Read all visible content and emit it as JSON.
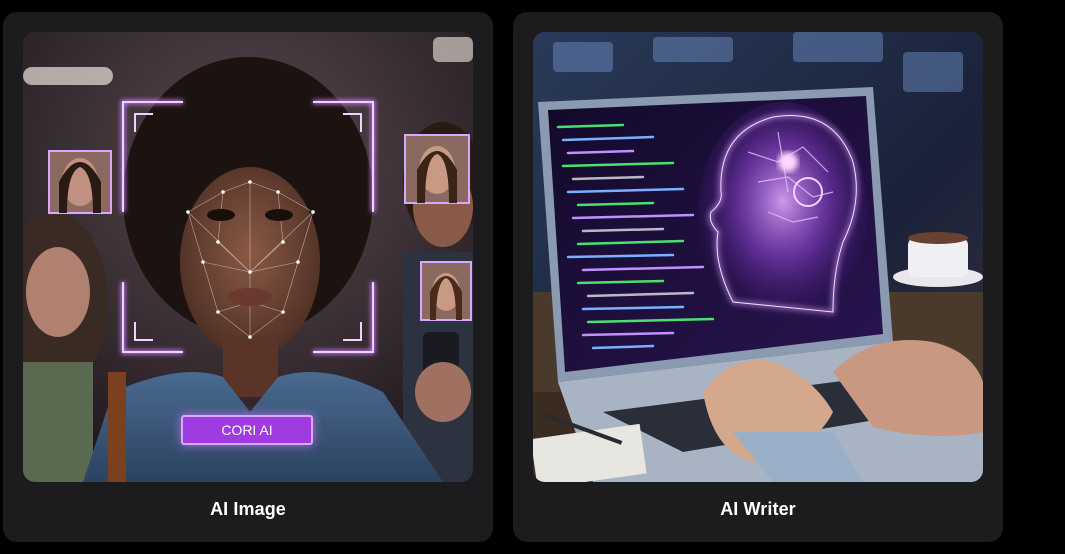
{
  "cards": [
    {
      "label": "AI Image",
      "badge": "CORI AI",
      "icon": "face-recognition-image"
    },
    {
      "label": "AI Writer",
      "icon": "ai-laptop-image"
    }
  ],
  "colors": {
    "page_bg": "#000000",
    "card_bg": "#1c1c1e",
    "label_text": "#ffffff",
    "accent_purple": "#b35cff"
  }
}
